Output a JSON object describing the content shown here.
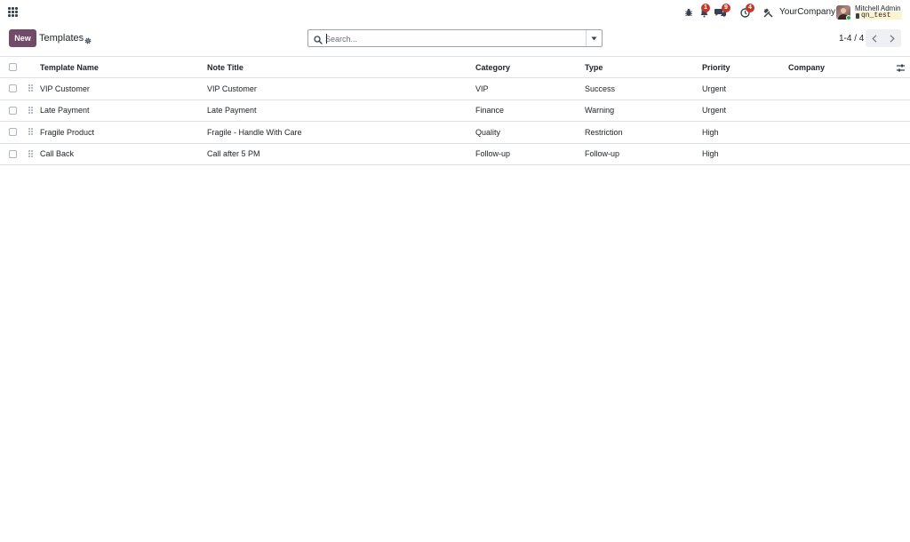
{
  "navbar": {
    "apps_icon": "apps-grid-icon",
    "bug_icon": "bug-icon",
    "activity_badge": "1",
    "messages_badge": "9",
    "clock_badge": "4",
    "tools_icon": "tools-icon",
    "company": "YourCompany",
    "user_name": "Mitchell Admin",
    "database": "qn_test"
  },
  "control_panel": {
    "new_label": "New",
    "title": "Templates",
    "search_placeholder": "Search...",
    "pager_value": "1-4 / 4"
  },
  "table": {
    "columns": [
      "Template Name",
      "Note Title",
      "Category",
      "Type",
      "Priority",
      "Company"
    ],
    "rows": [
      {
        "name": "VIP Customer",
        "note": "VIP Customer",
        "category": "VIP",
        "type": "Success",
        "priority": "Urgent",
        "company": ""
      },
      {
        "name": "Late Payment",
        "note": "Late Payment",
        "category": "Finance",
        "type": "Warning",
        "priority": "Urgent",
        "company": ""
      },
      {
        "name": "Fragile Product",
        "note": "Fragile - Handle With Care",
        "category": "Quality",
        "type": "Restriction",
        "priority": "High",
        "company": ""
      },
      {
        "name": "Call Back",
        "note": "Call after 5 PM",
        "category": "Follow-up",
        "type": "Follow-up",
        "priority": "High",
        "company": ""
      }
    ]
  },
  "colors": {
    "primary": "#714b67",
    "badge": "#c0392b",
    "online": "#28a745",
    "db_chip": "#fdf3d1"
  }
}
